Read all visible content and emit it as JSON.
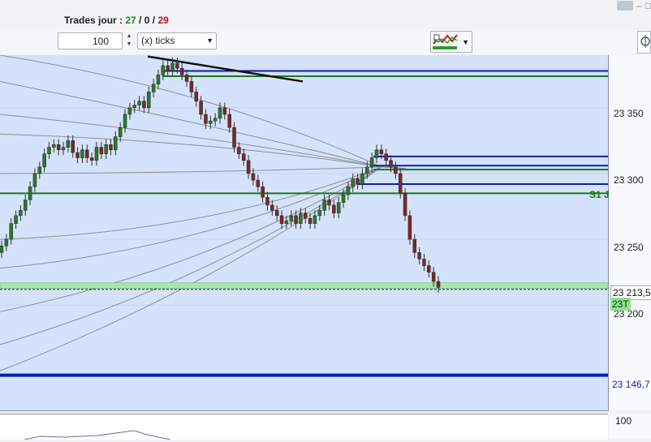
{
  "header": {
    "trades_label": "Trades jour : ",
    "trades_wins": "27",
    "trades_sep1": " / ",
    "trades_flat": "0",
    "trades_sep2": " / ",
    "trades_total": "29"
  },
  "toolbar": {
    "quantity_value": "100",
    "unit_select": "(x) ticks"
  },
  "chart": {
    "price_axis_ticks": [
      "23 350",
      "23 300",
      "23 250",
      "23 200"
    ],
    "last_price_tag": "23 213,5",
    "position_tag": "23T",
    "support_tag": "23 146,7",
    "s1_label": "S1 J",
    "sub_axis_tick": "100",
    "colors": {
      "background": "#d5e2fb",
      "level_blue": "#0b1fb0",
      "level_green": "#1a7a1a",
      "trendline": "#111111",
      "candle_bull": "#2a7a2a",
      "candle_bear": "#7a2a2a"
    }
  },
  "chart_data": {
    "type": "candlestick",
    "ylim": [
      23120,
      23390
    ],
    "candles_close": [
      23245,
      23250,
      23262,
      23268,
      23272,
      23280,
      23290,
      23300,
      23305,
      23315,
      23320,
      23322,
      23318,
      23320,
      23325,
      23316,
      23312,
      23318,
      23312,
      23310,
      23320,
      23315,
      23322,
      23318,
      23328,
      23335,
      23345,
      23350,
      23352,
      23355,
      23350,
      23362,
      23368,
      23375,
      23382,
      23378,
      23384,
      23380,
      23375,
      23370,
      23362,
      23355,
      23345,
      23338,
      23340,
      23342,
      23350,
      23345,
      23335,
      23320,
      23315,
      23310,
      23300,
      23295,
      23290,
      23282,
      23276,
      23272,
      23268,
      23262,
      23264,
      23268,
      23262,
      23270,
      23266,
      23262,
      23268,
      23272,
      23280,
      23276,
      23270,
      23278,
      23284,
      23290,
      23296,
      23292,
      23300,
      23305,
      23312,
      23318,
      23315,
      23310,
      23305,
      23300,
      23285,
      23268,
      23250,
      23240,
      23235,
      23230,
      23225,
      23218,
      23213.5
    ],
    "levels": [
      {
        "label": "",
        "value": 23378,
        "color": "blue"
      },
      {
        "label": "",
        "value": 23374,
        "color": "green"
      },
      {
        "label": "",
        "value": 23313,
        "color": "blue"
      },
      {
        "label": "",
        "value": 23306,
        "color": "blue"
      },
      {
        "label": "",
        "value": 23303,
        "color": "green"
      },
      {
        "label": "",
        "value": 23292,
        "color": "blue"
      },
      {
        "label": "S1 J",
        "value": 23285,
        "color": "green"
      },
      {
        "label": "23 213,5",
        "value": 23214,
        "color": "green"
      },
      {
        "label": "23 146,7",
        "value": 23146.7,
        "color": "blue"
      }
    ]
  }
}
